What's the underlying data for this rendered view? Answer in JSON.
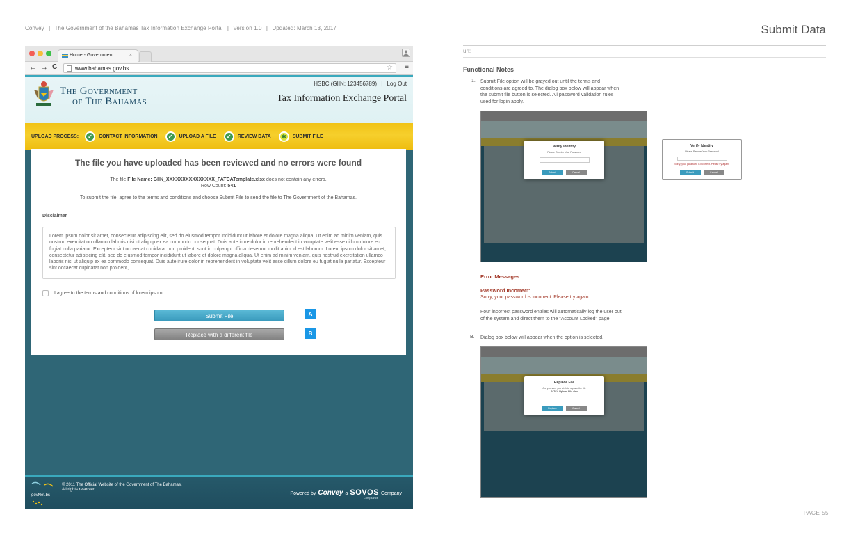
{
  "doc_header": {
    "brand": "Convey",
    "sep1": "|",
    "portal_name": "The Government of the Bahamas Tax Information Exchange Portal",
    "sep2": "|",
    "version": "Version 1.0",
    "sep3": "|",
    "updated": "Updated: March 13, 2017"
  },
  "page_title": "Submit Data",
  "url_label": "url:",
  "browser": {
    "tab_title": "Home - Government",
    "tab_close": "×",
    "url": "www.bahamas.gov.bs",
    "back": "←",
    "forward": "→",
    "reload": "C",
    "star": "☆",
    "menu": "≡"
  },
  "site": {
    "gov_name_line1": "The Government",
    "gov_name_line2": "of The Bahamas",
    "account": "HSBC (GIIN: 123456789)",
    "account_sep": "|",
    "logout": "Log Out",
    "portal_title": "Tax Information Exchange Portal"
  },
  "process": {
    "label": "UPLOAD PROCESS:",
    "steps": [
      {
        "label": "CONTACT INFORMATION"
      },
      {
        "label": "UPLOAD A FILE"
      },
      {
        "label": "REVIEW DATA"
      },
      {
        "label": "SUBMIT FILE"
      }
    ]
  },
  "content": {
    "headline": "The file you have uploaded has been reviewed and no errors were found",
    "file_prefix": "The file",
    "file_name_label": "File Name:",
    "file_name": "GIIN_XXXXXXXXXXXXXXX_FATCATemplate.xlsx",
    "file_suffix": "does not contain any errors.",
    "row_count_label": "Row Count:",
    "row_count": "541",
    "submit_instruction": "To submit the file, agree to the terms and conditions and choose Submit File to send the file to The Government of the Bahamas.",
    "disclaimer_heading": "Disclaimer",
    "disclaimer_text": "Lorem ipsum dolor sit amet, consectetur adipiscing elit, sed do eiusmod tempor incididunt ut labore et dolore magna aliqua. Ut enim ad minim veniam, quis nostrud exercitation ullamco laboris nisi ut aliquip ex ea commodo consequat. Duis aute irure dolor in reprehenderit in voluptate velit esse cillum dolore eu fugiat nulla pariatur. Excepteur sint occaecat cupidatat non proident, sunt in culpa qui officia deserunt mollit anim id est laborum.  Lorem ipsum dolor sit amet, consectetur adipiscing elit, sed do eiusmod tempor incididunt ut labore et dolore magna aliqua. Ut enim ad minim veniam, quis nostrud exercitation ullamco laboris nisi ut aliquip ex ea commodo consequat. Duis aute irure dolor in reprehenderit in voluptate velit esse cillum dolore eu fugiat nulla pariatur. Excepteur sint occaecat cupidatat non proident,",
    "agree_label": "I agree to the terms and conditions of lorem ipsum",
    "submit_label": "Submit File",
    "replace_label": "Replace with a different file",
    "callout_a": "A",
    "callout_b": "B"
  },
  "footer": {
    "logo_text": "govNet.bs",
    "copyright_line1": "© 2011 The Official Website of the Government of The Bahamas.",
    "copyright_line2": "All rights reserved.",
    "powered_by": "Powered by",
    "convey": "Convey",
    "a": "a",
    "sovos": "SOVOS",
    "company": "Company",
    "compliance": "Compliance"
  },
  "notes": {
    "heading": "Functional Notes",
    "item1_num": "1.",
    "item1_text_l1": "Submit File option will be grayed out until the terms and",
    "item1_text_l2": "conditions are agreed to. The dialog box below will appear when",
    "item1_text_l3": "the submit file button is selected. All password validation rules",
    "item1_text_l4": "used for login apply.",
    "verify_title": "Verify Identity",
    "verify_sub": "Please Reenter Your Password",
    "verify_error": "Sorry, your password is incorrect. Please try again.",
    "submit_btn": "Submit",
    "cancel_btn": "Cancel",
    "error_heading": "Error Messages:",
    "error_sub": "Password Incorrect:",
    "error_msg": "Sorry, your password is incorrect. Please try again.",
    "lock_l1": "Four incorrect password entries will automatically log the user out",
    "lock_l2": "of the system and direct them to the \"Account Locked\" page.",
    "item2_num": "B.",
    "item2_text": "Dialog box below will appear when the option is selected.",
    "replace_title": "Replace File",
    "replace_sub_l1": "Are you sure you wish to replace the file",
    "replace_sub_l2": "FATCA Upload File.xlsx",
    "replace_btn": "Replace"
  },
  "page_number": "PAGE  55",
  "colors": {
    "accent_teal": "#3aa9bd",
    "process_yellow": "#f1c316",
    "step_green": "#3e9a4f",
    "submit_blue": "#3b9bbd",
    "callout_blue": "#1a97e6",
    "error_red": "#a33a2a",
    "site_background": "#2f6676"
  }
}
